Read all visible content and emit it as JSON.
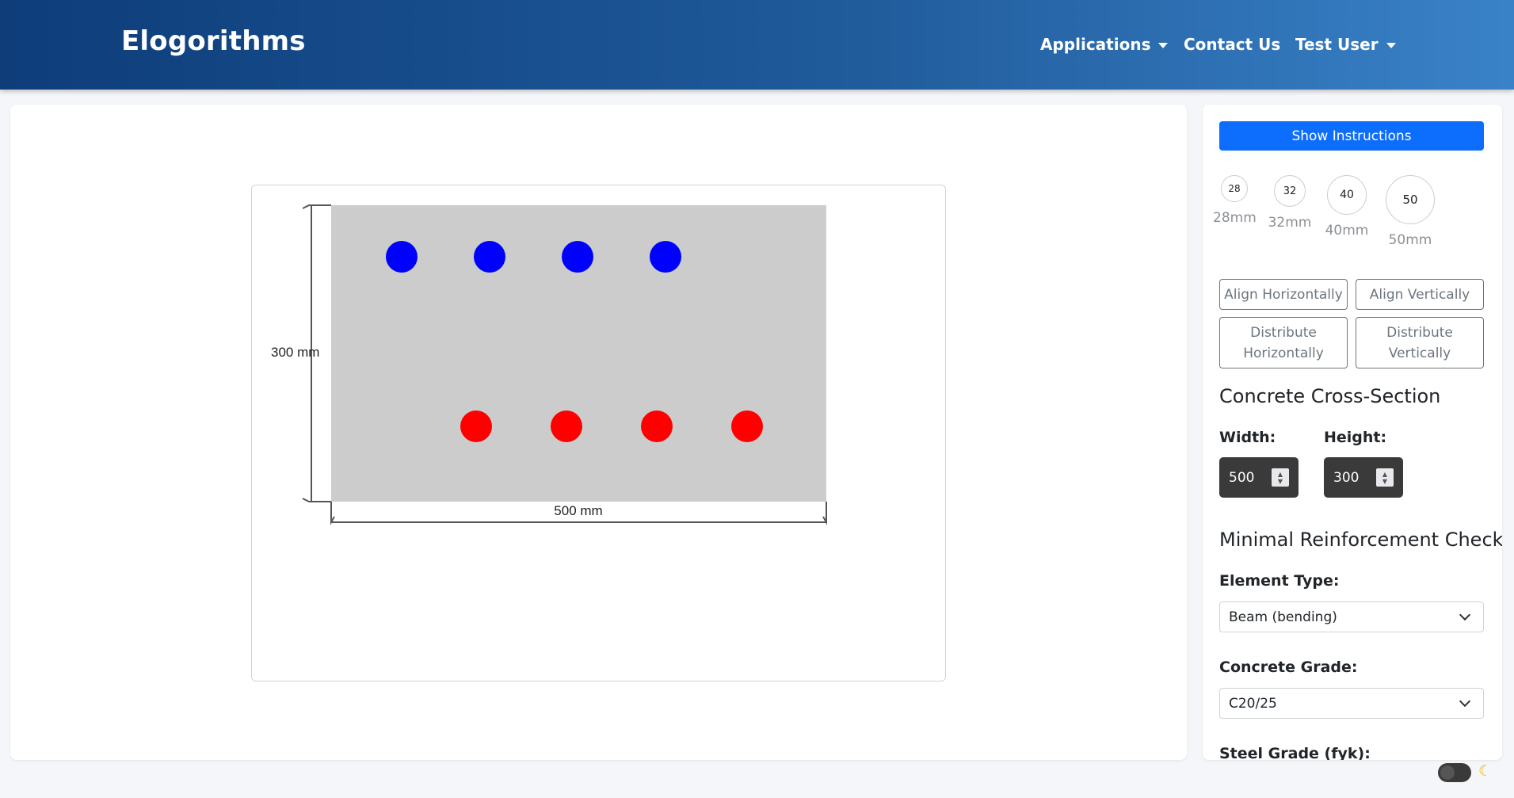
{
  "navbar": {
    "brand": "Elogorithms",
    "items": [
      {
        "label": "Applications",
        "has_dropdown": true
      },
      {
        "label": "Contact Us",
        "has_dropdown": false
      },
      {
        "label": "Test User",
        "has_dropdown": true
      }
    ]
  },
  "canvas": {
    "width_label": "500 mm",
    "height_label": "300 mm",
    "section_color": "#cccccc",
    "top_bars_color": "#0000ff",
    "bottom_bars_color": "#ff0000",
    "top_bar_count": 4,
    "bottom_bar_count": 4
  },
  "sidebar": {
    "instructions_button": "Show Instructions",
    "bar_sizes": [
      {
        "value": "28",
        "label": "28mm"
      },
      {
        "value": "32",
        "label": "32mm"
      },
      {
        "value": "40",
        "label": "40mm"
      },
      {
        "value": "50",
        "label": "50mm"
      }
    ],
    "align_horizontally": "Align Horizontally",
    "align_vertically": "Align Vertically",
    "distribute_horizontally": "Distribute Horizontally",
    "distribute_vertically": "Distribute Vertically",
    "cross_section_title": "Concrete Cross-Section",
    "width_label": "Width:",
    "height_label": "Height:",
    "width_value": "500",
    "height_value": "300",
    "min_reinf_title": "Minimal Reinforcement Check",
    "element_type_label": "Element Type:",
    "element_type_value": "Beam (bending)",
    "concrete_grade_label": "Concrete Grade:",
    "concrete_grade_value": "C20/25",
    "steel_grade_label": "Steel Grade (fyk):"
  },
  "theme": {
    "icon": "moon-icon",
    "dark_mode": false
  },
  "colors": {
    "primary": "#0d6efd",
    "navbar_start": "#0e3d7a",
    "navbar_end": "#3a82c8"
  }
}
